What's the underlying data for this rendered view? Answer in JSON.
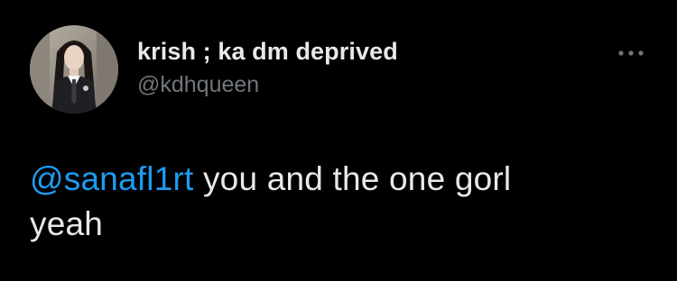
{
  "user": {
    "display_name": "krish ; ka dm deprived",
    "handle": "@kdhqueen",
    "avatar_icon": "profile-photo"
  },
  "menu": {
    "icon": "more-horizontal-icon"
  },
  "tweet": {
    "mention": "@sanafl1rt",
    "text_line1": " you and the one gorl",
    "text_line2": "yeah"
  },
  "colors": {
    "background": "#000000",
    "primary_text": "#e7e9ea",
    "secondary_text": "#71767b",
    "link": "#1d9bf0"
  }
}
